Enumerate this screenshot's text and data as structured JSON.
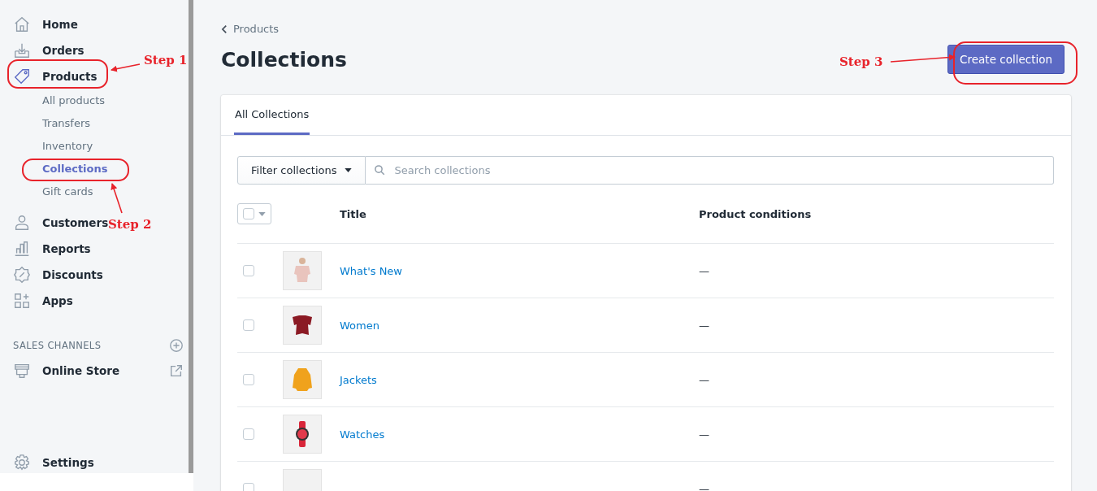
{
  "sidebar": {
    "items": [
      {
        "label": "Home",
        "selected": false
      },
      {
        "label": "Orders",
        "selected": false
      },
      {
        "label": "Products",
        "selected": true,
        "children": [
          {
            "label": "All products",
            "selected": false
          },
          {
            "label": "Transfers",
            "selected": false
          },
          {
            "label": "Inventory",
            "selected": false
          },
          {
            "label": "Collections",
            "selected": true
          },
          {
            "label": "Gift cards",
            "selected": false
          }
        ]
      },
      {
        "label": "Customers",
        "selected": false
      },
      {
        "label": "Reports",
        "selected": false
      },
      {
        "label": "Discounts",
        "selected": false
      },
      {
        "label": "Apps",
        "selected": false
      }
    ],
    "section": {
      "title": "SALES CHANNELS",
      "items": [
        {
          "label": "Online Store"
        }
      ]
    },
    "settings": {
      "label": "Settings"
    }
  },
  "breadcrumb": "Products",
  "page_title": "Collections",
  "primary_button": "Create collection",
  "tabs": [
    {
      "label": "All Collections",
      "selected": true
    }
  ],
  "filter": {
    "label": "Filter collections"
  },
  "search": {
    "placeholder": "Search collections"
  },
  "table": {
    "columns": [
      "Title",
      "Product conditions"
    ],
    "select_all_checked": false,
    "rows": [
      {
        "title": "What's New",
        "conditions": "—",
        "checked": false
      },
      {
        "title": "Women",
        "conditions": "—",
        "checked": false
      },
      {
        "title": "Jackets",
        "conditions": "—",
        "checked": false
      },
      {
        "title": "Watches",
        "conditions": "—",
        "checked": false
      },
      {
        "conditions": "—",
        "checked": false
      }
    ]
  },
  "annotations": [
    {
      "text": "Step 1"
    },
    {
      "text": "Step 2"
    },
    {
      "text": "Step 3"
    }
  ]
}
